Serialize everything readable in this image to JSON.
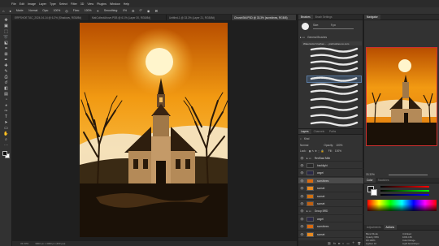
{
  "app": {
    "logo": "Ps",
    "share_label": "Share"
  },
  "menu": [
    "File",
    "Edit",
    "Image",
    "Layer",
    "Type",
    "Select",
    "Filter",
    "3D",
    "View",
    "Plugins",
    "Window",
    "Help"
  ],
  "options": {
    "mode_label": "Mode:",
    "mode_value": "Normal",
    "opacity_label": "Opa:",
    "opacity_value": "100%",
    "flow_label": "Flow:",
    "flow_value": "100%",
    "smoothing_label": "Smoothing:",
    "smoothing_value": "0%",
    "angle_value": "0°"
  },
  "tabs": [
    {
      "label": "ERPSHOE TAC_2024-04-14 @ 6.2% (Shadows, RGB/8#)",
      "active": false
    },
    {
      "label": "MatCollectAbove.PSB @ 6.1% (Layer 30, RGB/8#)",
      "active": false
    },
    {
      "label": "Untitled-1 @ 33.3% (Layer 21, RGB/8#)",
      "active": false
    },
    {
      "label": "ChurchStill.PSD @ 33.3% (sunshines, RGB/8)",
      "active": true
    }
  ],
  "status": {
    "zoom": "33.33%",
    "doc": "3000 px x 4000 px (300 ppi)"
  },
  "brush_panel": {
    "tabs": [
      "Brushes",
      "Brush Settings"
    ],
    "size_label": "Size:",
    "size_value": "9 px",
    "group": "General Brushes",
    "selected": "Watercolor brushes - ...yrebrushes.co.com"
  },
  "layers_panel": {
    "tabs": [
      "Layers",
      "Channels",
      "Paths"
    ],
    "kind": "Kind",
    "blend": "Normal",
    "opacity_label": "Opacity:",
    "opacity_value": "100%",
    "lock_label": "Lock:",
    "fill_label": "Fill:",
    "fill_value": "100%",
    "layers": [
      {
        "name": "RedSaul Mbb",
        "group": true
      },
      {
        "name": "backlight",
        "thumb": "#2a2a2a"
      },
      {
        "name": "angel",
        "thumb": "#2a2846"
      },
      {
        "name": "sunshines",
        "thumb": "#d86a10",
        "selected": true
      },
      {
        "name": "sunset",
        "thumb": "#e88a20"
      },
      {
        "name": "sunset",
        "thumb": "#d07010"
      },
      {
        "name": "sunset",
        "thumb": "#c06010"
      },
      {
        "name": "Group BRD",
        "group": true
      },
      {
        "name": "angel",
        "thumb": "#2a2846"
      },
      {
        "name": "sunshines",
        "thumb": "#d86a10"
      },
      {
        "name": "sunset",
        "thumb": "#e88a20"
      }
    ]
  },
  "right_panel": {
    "tabs": [
      "Navigator"
    ],
    "zoom": "33.33%",
    "color_tabs": [
      "Color",
      "Swatches"
    ],
    "prop_tabs": [
      "Adjustments",
      "Actions"
    ],
    "props": [
      [
        "Blend Mode",
        "Unlinked"
      ],
      [
        "Opacity 98%",
        "1000-150"
      ],
      [
        "Fill 100%",
        "Color Range"
      ],
      [
        "Lighten 10",
        "Light AutoOnlyer"
      ]
    ]
  },
  "colors": {
    "accent": "#1473e6",
    "sky_top": "#c45a00",
    "sky_mid": "#f29a12",
    "sun": "#fff0b0",
    "ground": "#1a1106"
  }
}
